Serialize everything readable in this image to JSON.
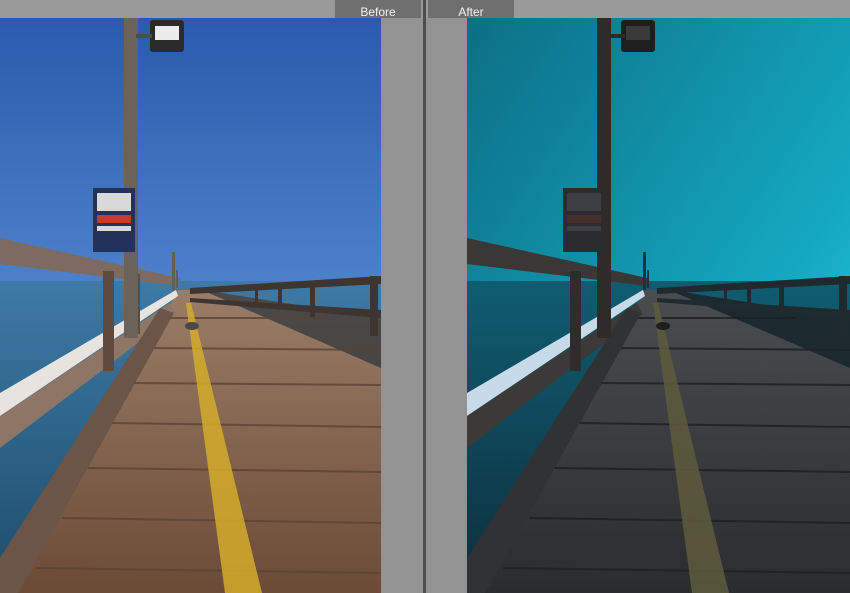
{
  "compare_view": {
    "before_label": "Before",
    "after_label": "After"
  },
  "colors": {
    "before_sky_top": "#2f63b7",
    "before_sky_horizon": "#a9c9f0",
    "after_sky_top": "#0c6f86",
    "after_sky_horizon": "#33d7ea",
    "deck_before": "#7b5a43",
    "deck_after": "#2f3235",
    "stripe_before": "#d4ac2a",
    "stripe_after": "#5e5a3d"
  },
  "icons": {
    "pier_lamp": "pier-lamp-icon",
    "sign": "sign-board-icon",
    "bird": "bird-icon"
  }
}
